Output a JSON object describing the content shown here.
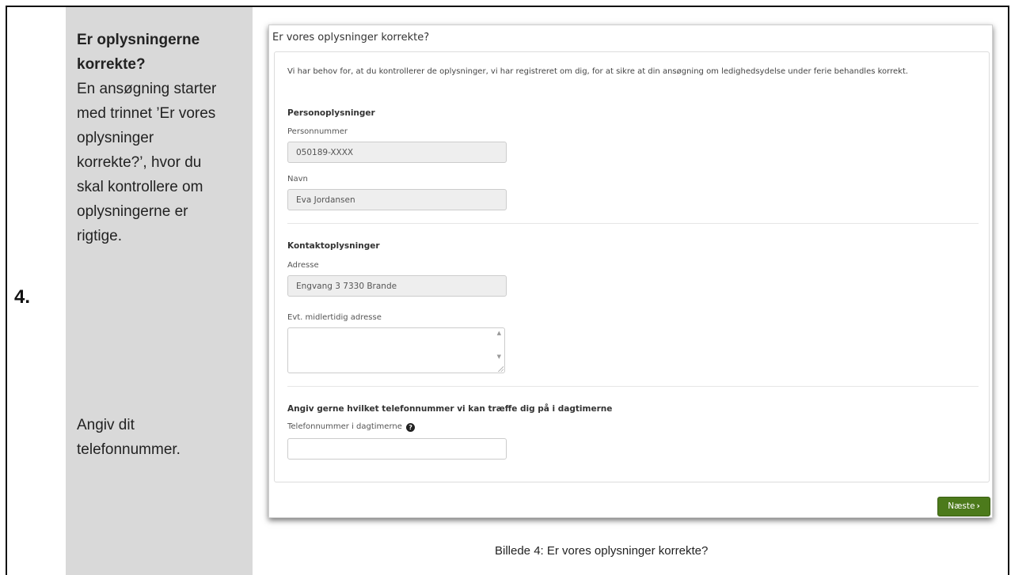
{
  "step": {
    "number": "4."
  },
  "description": {
    "heading_line1": "Er oplysningerne",
    "heading_line2": "korrekte?",
    "lines": [
      "En ansøgning starter",
      "med trinnet ’Er vores",
      "oplysninger",
      "korrekte?’, hvor du",
      "skal kontrollere om",
      "oplysningerne er",
      "rigtige."
    ],
    "phone_lines": [
      "Angiv dit",
      "telefonnummer."
    ]
  },
  "form": {
    "title": "Er vores oplysninger korrekte?",
    "intro": "Vi har behov for, at du kontrollerer de oplysninger, vi har registreret om dig, for at sikre at din ansøgning om ledighedsydelse under ferie behandles korrekt.",
    "personal": {
      "heading": "Personoplysninger",
      "cpr_label": "Personnummer",
      "cpr_value": "050189-XXXX",
      "name_label": "Navn",
      "name_value": "Eva Jordansen"
    },
    "contact": {
      "heading": "Kontaktoplysninger",
      "address_label": "Adresse",
      "address_value": "Engvang 3 7330 Brande",
      "temp_address_label": "Evt. midlertidig adresse",
      "temp_address_value": ""
    },
    "phone": {
      "heading": "Angiv gerne hvilket telefonnummer vi kan træffe dig på i dagtimerne",
      "label": "Telefonnummer i dagtimerne",
      "help_glyph": "?",
      "value": ""
    },
    "next_label": "Næste",
    "next_icon": "chevron-right-icon"
  },
  "caption": "Billede 4: Er vores oplysninger korrekte?"
}
